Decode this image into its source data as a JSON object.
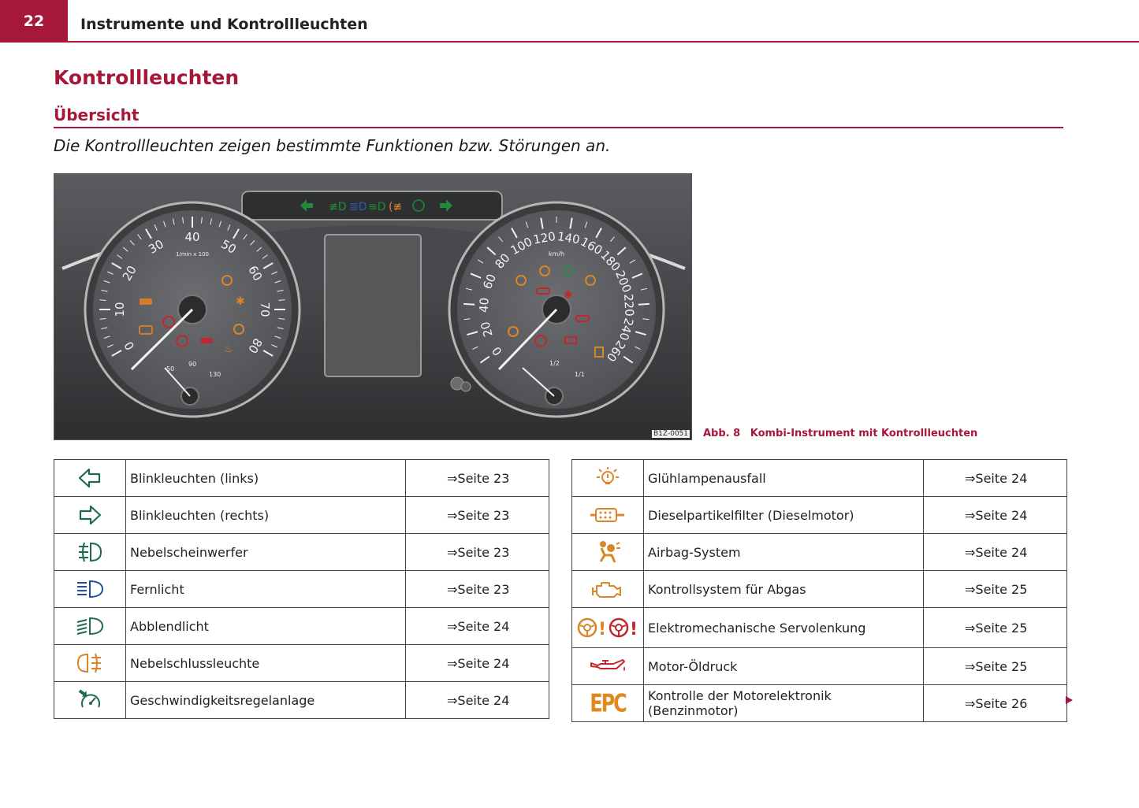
{
  "header": {
    "page_number": "22",
    "title": "Instrumente und Kontrollleuchten"
  },
  "section": {
    "title": "Kontrollleuchten",
    "subtitle": "Übersicht",
    "intro": "Die Kontrollleuchten zeigen bestimmte Funktionen bzw. Störungen an."
  },
  "figure": {
    "id_label": "B1Z-0051",
    "caption_label": "Abb. 8",
    "caption_text": "Kombi-Instrument mit Kontrollleuchten",
    "rpm_unit": "1/min x 100",
    "rpm_ticks": [
      "0",
      "10",
      "20",
      "30",
      "40",
      "50",
      "60",
      "70",
      "80"
    ],
    "temp_labels": [
      "50",
      "90",
      "130"
    ],
    "speed_unit": "km/h",
    "speed_ticks": [
      "0",
      "20",
      "40",
      "60",
      "80",
      "100",
      "120",
      "140",
      "160",
      "180",
      "200",
      "220",
      "240",
      "260"
    ],
    "fuel_labels": [
      "1/2",
      "1/1"
    ]
  },
  "left_table": [
    {
      "icon": "turn-left-arrow-icon",
      "name": "Blinkleuchten (links)",
      "ref": "⇒Seite 23"
    },
    {
      "icon": "turn-right-arrow-icon",
      "name": "Blinkleuchten (rechts)",
      "ref": "⇒Seite 23"
    },
    {
      "icon": "fog-light-icon",
      "name": "Nebelscheinwerfer",
      "ref": "⇒Seite 23"
    },
    {
      "icon": "high-beam-icon",
      "name": "Fernlicht",
      "ref": "⇒Seite 23"
    },
    {
      "icon": "low-beam-icon",
      "name": "Abblendlicht",
      "ref": "⇒Seite 24"
    },
    {
      "icon": "rear-fog-light-icon",
      "name": "Nebelschlussleuchte",
      "ref": "⇒Seite 24"
    },
    {
      "icon": "cruise-control-icon",
      "name": "Geschwindigkeitsregelanlage",
      "ref": "⇒Seite 24"
    }
  ],
  "right_table": [
    {
      "icon": "bulb-failure-icon",
      "name": "Glühlampenausfall",
      "ref": "⇒Seite 24"
    },
    {
      "icon": "diesel-particle-filter-icon",
      "name": "Dieselpartikelfilter (Dieselmotor)",
      "ref": "⇒Seite 24"
    },
    {
      "icon": "airbag-icon",
      "name": "Airbag-System",
      "ref": "⇒Seite 24"
    },
    {
      "icon": "engine-check-icon",
      "name": "Kontrollsystem für Abgas",
      "ref": "⇒Seite 25"
    },
    {
      "icon": "power-steering-icon",
      "name": "Elektromechanische Servolenkung",
      "ref": "⇒Seite 25"
    },
    {
      "icon": "oil-pressure-icon",
      "name": "Motor-Öldruck",
      "ref": "⇒Seite 25"
    },
    {
      "icon": "epc-icon",
      "name": "Kontrolle der Motorelektronik (Benzinmotor)",
      "ref": "⇒Seite 26",
      "icon_text": "EPC"
    }
  ],
  "colors": {
    "accent": "#a6183a",
    "green_lamp": "#1e6b4a",
    "amber_lamp": "#e08a1e",
    "red_lamp": "#c0282d",
    "blue_lamp": "#1f4e9c"
  }
}
